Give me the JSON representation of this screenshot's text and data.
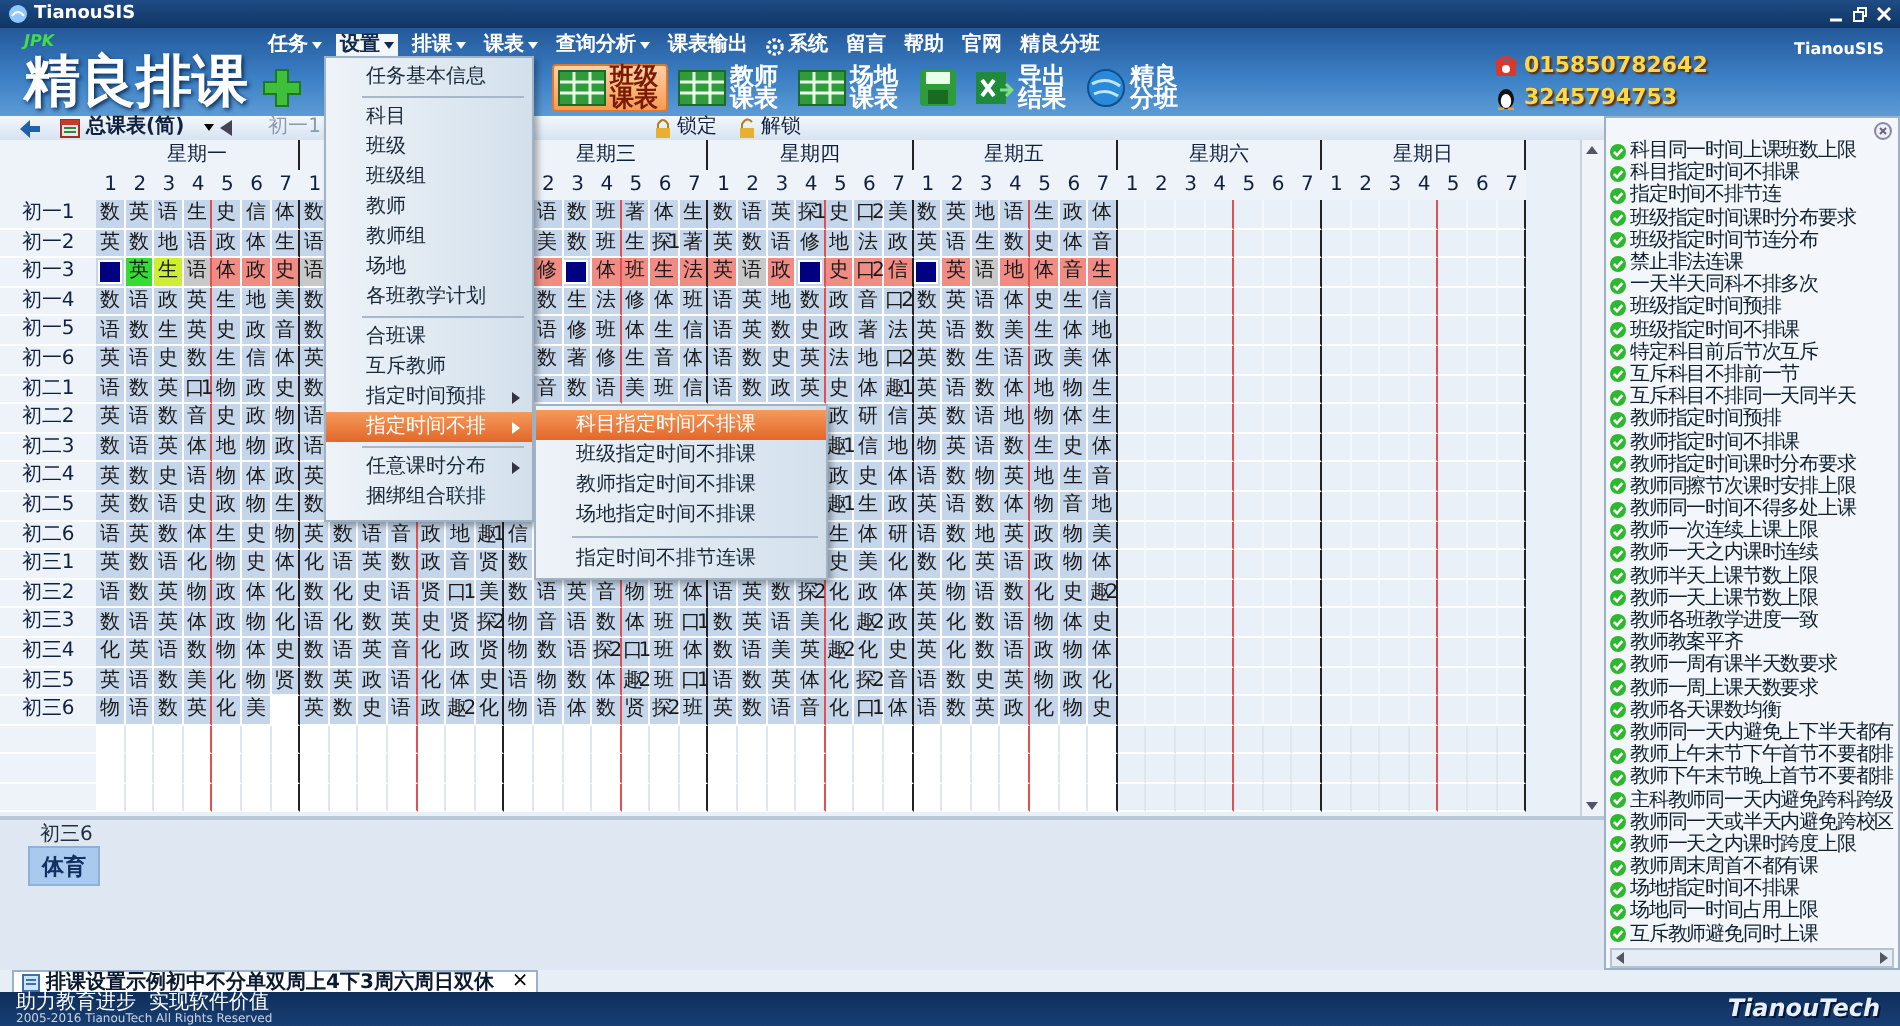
{
  "window": {
    "title": "TianouSIS",
    "brand": "TianouSIS"
  },
  "menu_bar": [
    {
      "label": "任务",
      "dropdown": true,
      "selected": false
    },
    {
      "label": "设置",
      "dropdown": true,
      "selected": true
    },
    {
      "label": "排课",
      "dropdown": true,
      "selected": false
    },
    {
      "label": "课表",
      "dropdown": true,
      "selected": false
    },
    {
      "label": "查询分析",
      "dropdown": true,
      "selected": false
    },
    {
      "label": "课表输出",
      "dropdown": false,
      "selected": false
    },
    {
      "label": "系统",
      "dropdown": false,
      "selected": false,
      "kind": "gear"
    },
    {
      "label": "留言",
      "dropdown": false,
      "selected": false
    },
    {
      "label": "帮助",
      "dropdown": false,
      "selected": false
    },
    {
      "label": "官网",
      "dropdown": false,
      "selected": false
    },
    {
      "label": "精良分班",
      "dropdown": false,
      "selected": false
    }
  ],
  "logo": {
    "badge": "JPK",
    "title": "精良排课"
  },
  "toolbar": [
    {
      "kind": "add",
      "selected": false
    },
    {
      "kind": "schedule",
      "label": "班级课表",
      "selected": true
    },
    {
      "kind": "schedule",
      "label": "教师课表",
      "selected": false
    },
    {
      "kind": "schedule",
      "label": "场地课表",
      "selected": false
    },
    {
      "kind": "save",
      "selected": false
    },
    {
      "kind": "export",
      "label": "导出结果",
      "selected": false
    },
    {
      "kind": "globe",
      "label": "精良分班",
      "selected": false
    }
  ],
  "contact": {
    "phone": "015850782642",
    "qq": "3245794753"
  },
  "view_bar": {
    "view": "总课表(简)",
    "current": "初一1",
    "actions": [
      {
        "kind": "lock",
        "label": "锁定"
      },
      {
        "kind": "unlock",
        "label": "解锁"
      }
    ]
  },
  "timetable": {
    "days": [
      {
        "name": "星期一",
        "periods": [
          "1",
          "2",
          "3",
          "4",
          "5",
          "6",
          "7"
        ]
      },
      {
        "periods": [
          "1"
        ]
      },
      {
        "name": "星期三",
        "periods": [
          "2",
          "3",
          "4",
          "5",
          "6",
          "7"
        ],
        "covered_start": true
      },
      {
        "name": "星期四",
        "periods": [
          "1",
          "2",
          "3",
          "4",
          "5",
          "6",
          "7"
        ]
      },
      {
        "name": "星期五",
        "periods": [
          "1",
          "2",
          "3",
          "4",
          "5",
          "6",
          "7"
        ]
      },
      {
        "name": "星期六",
        "periods": [
          "1",
          "2",
          "3",
          "4",
          "5",
          "6",
          "7"
        ]
      },
      {
        "name": "星期日",
        "periods": [
          "1",
          "2",
          "3",
          "4",
          "5",
          "6",
          "7"
        ]
      }
    ],
    "rows": [
      {
        "class": "初一1",
        "cells": [
          "数",
          "英",
          "语",
          "生",
          "史",
          "信",
          "体",
          "数",
          null,
          null,
          null,
          null,
          null,
          null,
          null,
          "语",
          "数",
          "班",
          "著",
          "体",
          "生",
          "数",
          "语",
          "英",
          "探1",
          "史",
          "口2",
          "美",
          "数",
          "英",
          "地",
          "语",
          "生",
          "政",
          "体"
        ]
      },
      {
        "class": "初一2",
        "cells": [
          "英",
          "数",
          "地",
          "语",
          "政",
          "体",
          "生",
          "语",
          null,
          null,
          null,
          null,
          null,
          null,
          null,
          "美",
          "数",
          "班",
          "生",
          "探1",
          "著",
          "英",
          "数",
          "语",
          "修",
          "地",
          "法",
          "政",
          "英",
          "语",
          "生",
          "数",
          "史",
          "体",
          "音"
        ]
      },
      {
        "class": "初一3",
        "cells": [
          {
            "color": "#000080"
          },
          {
            "text": "英",
            "color": "#33dd33"
          },
          {
            "text": "生",
            "color": "#ccee33"
          },
          {
            "text": "语",
            "color": "#c8c8c8"
          },
          {
            "text": "体",
            "color": "#f08c84"
          },
          {
            "text": "政",
            "color": "#f08c84"
          },
          {
            "text": "史",
            "color": "#f08c84"
          },
          {
            "text": "语",
            "color": "#c8c8c8"
          },
          null,
          null,
          null,
          null,
          null,
          null,
          null,
          {
            "text": "修",
            "color": "#f08c84"
          },
          {
            "color": "#000080"
          },
          {
            "text": "体",
            "color": "#f08c84"
          },
          {
            "text": "班",
            "color": "#f08c84"
          },
          {
            "text": "生",
            "color": "#f08c84"
          },
          {
            "text": "法",
            "color": "#f08c84"
          },
          {
            "text": "英",
            "color": "#f08c84"
          },
          {
            "text": "语",
            "color": "#c8c8c8"
          },
          {
            "text": "政",
            "color": "#f08c84"
          },
          {
            "color": "#000080"
          },
          {
            "text": "史",
            "color": "#f08c84"
          },
          {
            "text": "口2",
            "color": "#f08c84"
          },
          {
            "text": "信",
            "color": "#f08c84"
          },
          {
            "color": "#000080"
          },
          {
            "text": "英",
            "color": "#f08c84"
          },
          {
            "text": "语",
            "color": "#c8c8c8"
          },
          {
            "text": "地",
            "color": "#f08c84"
          },
          {
            "text": "体",
            "color": "#f08c84"
          },
          {
            "text": "音",
            "color": "#f08c84"
          },
          {
            "text": "生",
            "color": "#f08c84"
          }
        ]
      },
      {
        "class": "初一4",
        "cells": [
          "数",
          "语",
          "政",
          "英",
          "生",
          "地",
          "美",
          "数",
          null,
          null,
          null,
          null,
          null,
          null,
          null,
          "数",
          "生",
          "法",
          "修",
          "体",
          "班",
          "语",
          "英",
          "地",
          "数",
          "政",
          "音",
          "口2",
          "数",
          "英",
          "语",
          "体",
          "史",
          "生",
          "信"
        ]
      },
      {
        "class": "初一5",
        "cells": [
          "语",
          "数",
          "生",
          "英",
          "史",
          "政",
          "音",
          "数",
          null,
          null,
          null,
          null,
          null,
          null,
          null,
          "语",
          "修",
          "班",
          "体",
          "生",
          "信",
          "语",
          "英",
          "数",
          "史",
          "政",
          "著",
          "法",
          "英",
          "语",
          "数",
          "美",
          "生",
          "体",
          "地"
        ]
      },
      {
        "class": "初一6",
        "cells": [
          "英",
          "语",
          "史",
          "数",
          "生",
          "信",
          "体",
          "英",
          null,
          null,
          null,
          null,
          null,
          null,
          null,
          "数",
          "著",
          "修",
          "生",
          "音",
          "体",
          "语",
          "数",
          "史",
          "英",
          "法",
          "地",
          "口2",
          "英",
          "数",
          "生",
          "语",
          "政",
          "美",
          "体"
        ]
      },
      {
        "class": "初二1",
        "cells": [
          "语",
          "数",
          "英",
          "口1",
          "物",
          "政",
          "史",
          "数",
          null,
          null,
          null,
          null,
          null,
          null,
          null,
          "音",
          "数",
          "语",
          "美",
          "班",
          "信",
          "语",
          "数",
          "政",
          "英",
          "史",
          "体",
          "趣1",
          "英",
          "语",
          "数",
          "体",
          "地",
          "物",
          "生"
        ]
      },
      {
        "class": "初二2",
        "cells": [
          "英",
          "语",
          "数",
          "音",
          "史",
          "政",
          "物",
          "语",
          null,
          null,
          null,
          null,
          null,
          null,
          null,
          null,
          null,
          null,
          null,
          null,
          null,
          null,
          null,
          null,
          null,
          "政",
          "研",
          "信",
          "英",
          "数",
          "语",
          "地",
          "物",
          "体",
          "生"
        ]
      },
      {
        "class": "初二3",
        "cells": [
          "数",
          "语",
          "英",
          "体",
          "地",
          "物",
          "政",
          "语",
          null,
          null,
          null,
          null,
          null,
          null,
          null,
          null,
          null,
          null,
          null,
          null,
          null,
          null,
          null,
          null,
          null,
          "趣1",
          "信",
          "地",
          "物",
          "英",
          "语",
          "数",
          "生",
          "史",
          "体"
        ]
      },
      {
        "class": "初二4",
        "cells": [
          "英",
          "数",
          "史",
          "语",
          "物",
          "体",
          "政",
          "英",
          null,
          null,
          null,
          null,
          null,
          null,
          null,
          null,
          null,
          null,
          null,
          null,
          null,
          null,
          null,
          null,
          null,
          "政",
          "史",
          "体",
          "语",
          "数",
          "物",
          "英",
          "地",
          "生",
          "音"
        ]
      },
      {
        "class": "初二5",
        "cells": [
          "英",
          "数",
          "语",
          "史",
          "政",
          "物",
          "生",
          "数",
          null,
          null,
          null,
          null,
          null,
          null,
          null,
          null,
          null,
          null,
          null,
          null,
          null,
          null,
          null,
          null,
          null,
          "趣1",
          "生",
          "政",
          "英",
          "语",
          "数",
          "体",
          "物",
          "音",
          "地"
        ]
      },
      {
        "class": "初二6",
        "cells": [
          "语",
          "英",
          "数",
          "体",
          "生",
          "史",
          "物",
          "英",
          "数",
          "语",
          "音",
          "政",
          "地",
          "趣1",
          "信",
          null,
          null,
          null,
          null,
          null,
          null,
          null,
          null,
          null,
          null,
          "生",
          "体",
          "研",
          "语",
          "数",
          "地",
          "英",
          "政",
          "物",
          "美"
        ]
      },
      {
        "class": "初三1",
        "cells": [
          "英",
          "数",
          "语",
          "化",
          "物",
          "史",
          "体",
          "化",
          "语",
          "英",
          "数",
          "政",
          "音",
          "贤",
          "数",
          null,
          null,
          null,
          null,
          null,
          null,
          null,
          null,
          null,
          null,
          "史",
          "美",
          "化",
          "数",
          "化",
          "英",
          "语",
          "政",
          "物",
          "体"
        ]
      },
      {
        "class": "初三2",
        "cells": [
          "语",
          "数",
          "英",
          "物",
          "政",
          "体",
          "化",
          "数",
          "化",
          "史",
          "语",
          "贤",
          "口1",
          "美",
          "数",
          "语",
          "英",
          "音",
          "物",
          "班",
          "体",
          "语",
          "英",
          "数",
          "探2",
          "化",
          "政",
          "体",
          "英",
          "物",
          "语",
          "数",
          "化",
          "史",
          "趣2"
        ]
      },
      {
        "class": "初三3",
        "cells": [
          "数",
          "语",
          "英",
          "体",
          "政",
          "物",
          "化",
          "语",
          "化",
          "数",
          "英",
          "史",
          "贤",
          "探2",
          "物",
          "音",
          "语",
          "数",
          "体",
          "班",
          "口1",
          "数",
          "英",
          "语",
          "美",
          "化",
          "趣2",
          "政",
          "英",
          "化",
          "数",
          "语",
          "物",
          "体",
          "史"
        ]
      },
      {
        "class": "初三4",
        "cells": [
          "化",
          "英",
          "语",
          "数",
          "物",
          "体",
          "史",
          "数",
          "语",
          "英",
          "音",
          "化",
          "政",
          "贤",
          "物",
          "数",
          "语",
          "探2",
          "口1",
          "班",
          "体",
          "数",
          "语",
          "美",
          "英",
          "趣2",
          "化",
          "史",
          "英",
          "化",
          "数",
          "语",
          "政",
          "物",
          "体"
        ]
      },
      {
        "class": "初三5",
        "cells": [
          "英",
          "语",
          "数",
          "美",
          "化",
          "物",
          "贤",
          "数",
          "英",
          "政",
          "语",
          "化",
          "体",
          "史",
          "语",
          "物",
          "数",
          "体",
          "趣2",
          "班",
          "口1",
          "语",
          "数",
          "英",
          "体",
          "化",
          "探2",
          "音",
          "语",
          "数",
          "史",
          "英",
          "物",
          "政",
          "化"
        ]
      },
      {
        "class": "初三6",
        "cells": [
          "物",
          "语",
          "数",
          "英",
          "化",
          "美",
          {
            "kind": "blank"
          },
          "英",
          "数",
          "史",
          "语",
          "政",
          "趣2",
          "化",
          "物",
          "语",
          "体",
          "数",
          "贤",
          "探2",
          "班",
          "英",
          "数",
          "语",
          "音",
          "化",
          "口1",
          "体",
          "语",
          "数",
          "英",
          "政",
          "化",
          "物",
          "史"
        ]
      }
    ]
  },
  "menu": {
    "items": [
      {
        "kind": "item",
        "label": "任务基本信息",
        "submenu": false,
        "selected": false
      },
      {
        "kind": "separator"
      },
      {
        "kind": "item",
        "label": "科目",
        "submenu": false,
        "selected": false
      },
      {
        "kind": "item",
        "label": "班级",
        "submenu": false,
        "selected": false
      },
      {
        "kind": "item",
        "label": "班级组",
        "submenu": false,
        "selected": false
      },
      {
        "kind": "item",
        "label": "教师",
        "submenu": false,
        "selected": false
      },
      {
        "kind": "item",
        "label": "教师组",
        "submenu": false,
        "selected": false
      },
      {
        "kind": "item",
        "label": "场地",
        "submenu": false,
        "selected": false
      },
      {
        "kind": "item",
        "label": "各班教学计划",
        "submenu": false,
        "selected": false
      },
      {
        "kind": "separator"
      },
      {
        "kind": "item",
        "label": "合班课",
        "submenu": false,
        "selected": false
      },
      {
        "kind": "item",
        "label": "互斥教师",
        "submenu": false,
        "selected": false
      },
      {
        "kind": "item",
        "label": "指定时间预排",
        "submenu": true,
        "selected": false
      },
      {
        "kind": "item",
        "label": "指定时间不排",
        "submenu": true,
        "selected": true
      },
      {
        "kind": "separator"
      },
      {
        "kind": "item",
        "label": "任意课时分布",
        "submenu": true,
        "selected": false
      },
      {
        "kind": "item",
        "label": "捆绑组合联排",
        "submenu": false,
        "selected": false
      }
    ],
    "submenu": [
      {
        "kind": "item",
        "label": "科目指定时间不排课",
        "selected": true
      },
      {
        "kind": "item",
        "label": "班级指定时间不排课",
        "selected": false
      },
      {
        "kind": "item",
        "label": "教师指定时间不排课",
        "selected": false
      },
      {
        "kind": "item",
        "label": "场地指定时间不排课",
        "selected": false
      },
      {
        "kind": "separator"
      },
      {
        "kind": "item",
        "label": "指定时间不排节连课",
        "selected": false
      }
    ]
  },
  "constraints": {
    "items": [
      {
        "label": "科目同一时间上课班数上限",
        "checked": true
      },
      {
        "label": "科目指定时间不排课",
        "checked": true
      },
      {
        "label": "指定时间不排节连",
        "checked": true
      },
      {
        "label": "班级指定时间课时分布要求",
        "checked": true
      },
      {
        "label": "班级指定时间节连分布",
        "checked": true
      },
      {
        "label": "禁止非法连课",
        "checked": true
      },
      {
        "label": "一天半天同科不排多次",
        "checked": true
      },
      {
        "label": "班级指定时间预排",
        "checked": true
      },
      {
        "label": "班级指定时间不排课",
        "checked": true
      },
      {
        "label": "特定科目前后节次互斥",
        "checked": true
      },
      {
        "label": "互斥科目不排前一节",
        "checked": true
      },
      {
        "label": "互斥科目不排同一天同半天",
        "checked": true
      },
      {
        "label": "教师指定时间预排",
        "checked": true
      },
      {
        "label": "教师指定时间不排课",
        "checked": true
      },
      {
        "label": "教师指定时间课时分布要求",
        "checked": true
      },
      {
        "label": "教师同擦节次课时安排上限",
        "checked": true
      },
      {
        "label": "教师同一时间不得多处上课",
        "checked": true
      },
      {
        "label": "教师一次连续上课上限",
        "checked": true
      },
      {
        "label": "教师一天之内课时连续",
        "checked": true
      },
      {
        "label": "教师半天上课节数上限",
        "checked": true
      },
      {
        "label": "教师一天上课节数上限",
        "checked": true
      },
      {
        "label": "教师各班教学进度一致",
        "checked": true
      },
      {
        "label": "教师教案平齐",
        "checked": true
      },
      {
        "label": "教师一周有课半天数要求",
        "checked": true
      },
      {
        "label": "教师一周上课天数要求",
        "checked": true
      },
      {
        "label": "教师各天课数均衡",
        "checked": true
      },
      {
        "label": "教师同一天内避免上下半天都有",
        "checked": true
      },
      {
        "label": "教师上午末节下午首节不要都排",
        "checked": true
      },
      {
        "label": "教师下午末节晚上首节不要都排",
        "checked": true
      },
      {
        "label": "主科教师同一天内避免跨科跨级",
        "checked": true
      },
      {
        "label": "教师同一天或半天内避免跨校区",
        "checked": true
      },
      {
        "label": "教师一天之内课时跨度上限",
        "checked": true
      },
      {
        "label": "教师周末周首不都有课",
        "checked": true
      },
      {
        "label": "场地指定时间不排课",
        "checked": true
      },
      {
        "label": "场地同一时间占用上限",
        "checked": true
      },
      {
        "label": "互斥教师避免同时上课",
        "checked": true
      }
    ]
  },
  "tray": {
    "label": "初三6",
    "chip": "体育"
  },
  "document_tab": {
    "title": "排课设置示例初中不分单双周上4下3周六周日双休",
    "close": "×"
  },
  "status_bar": {
    "slogan": "助力教育进步  实现软件价值",
    "copyright": "2005-2016 TianouTech All Rights Reserved",
    "logo": "TianouTech"
  }
}
